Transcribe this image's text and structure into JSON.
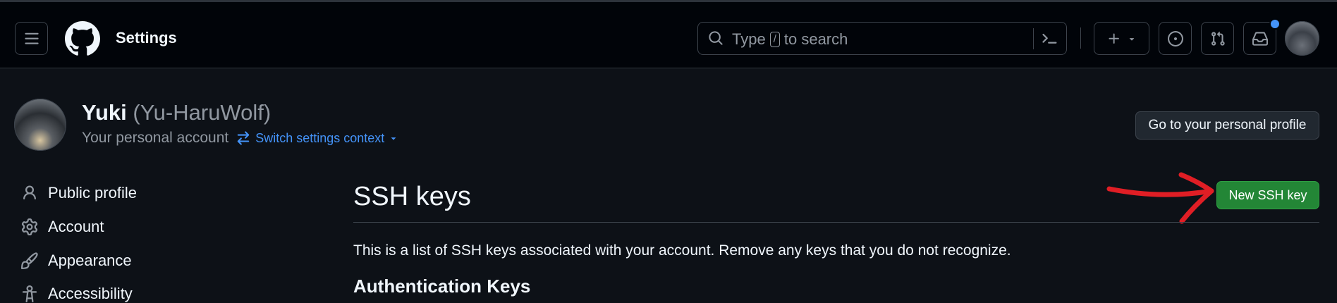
{
  "header": {
    "title": "Settings",
    "search_placeholder_before": "Type",
    "search_key": "/",
    "search_placeholder_after": "to search",
    "icons": [
      "hamburger-icon",
      "github-logo",
      "search-icon",
      "command-palette-icon",
      "plus-icon",
      "chevron-down-icon",
      "issues-icon",
      "pull-request-icon",
      "inbox-icon"
    ]
  },
  "account": {
    "display_name": "Yuki",
    "login": "(Yu-HaruWolf)",
    "subtitle": "Your personal account",
    "switch_context": "Switch settings context",
    "profile_button": "Go to your personal profile"
  },
  "sidebar": {
    "items": [
      {
        "label": "Public profile",
        "icon": "person-icon"
      },
      {
        "label": "Account",
        "icon": "gear-icon"
      },
      {
        "label": "Appearance",
        "icon": "paintbrush-icon"
      },
      {
        "label": "Accessibility",
        "icon": "accessibility-icon"
      }
    ]
  },
  "main": {
    "title": "SSH keys",
    "new_button": "New SSH key",
    "description": "This is a list of SSH keys associated with your account. Remove any keys that you do not recognize.",
    "section_title": "Authentication Keys"
  },
  "colors": {
    "background": "#0d1117",
    "header_bg": "#010409",
    "accent_link": "#4493f8",
    "primary_button": "#238636",
    "annotation_arrow": "#e01e25"
  }
}
